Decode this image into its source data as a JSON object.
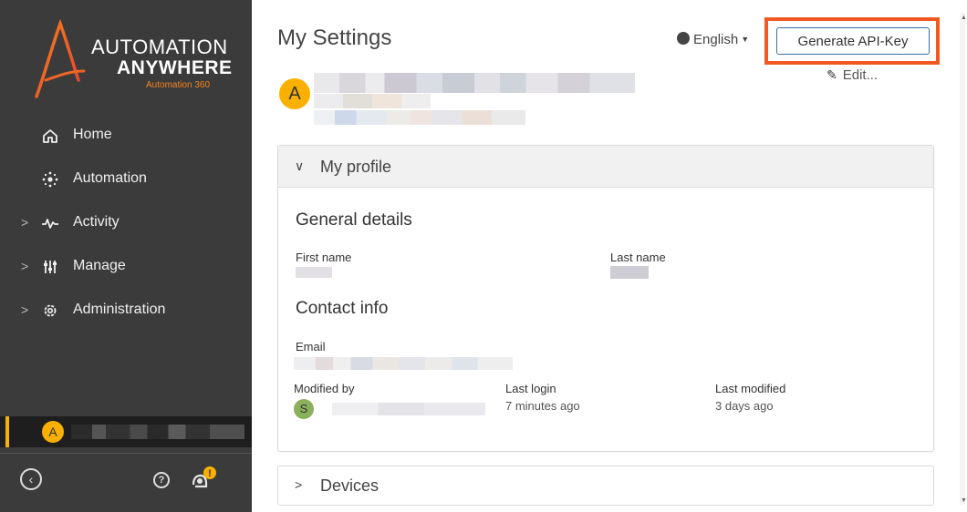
{
  "sidebar": {
    "logo": {
      "line1": "AUTOMATION",
      "line2": "ANYWHERE",
      "line3": "Automation 360",
      "accent_color": "#f58220"
    },
    "nav": [
      {
        "label": "Home",
        "icon": "home-icon",
        "expandable": false
      },
      {
        "label": "Automation",
        "icon": "automation-icon",
        "expandable": false
      },
      {
        "label": "Activity",
        "icon": "activity-icon",
        "expandable": true
      },
      {
        "label": "Manage",
        "icon": "manage-icon",
        "expandable": true
      },
      {
        "label": "Administration",
        "icon": "gear-icon",
        "expandable": true
      }
    ],
    "user": {
      "initial": "A"
    },
    "footer": {
      "collapse_glyph": "‹",
      "help_glyph": "?",
      "alert_glyph": "!"
    }
  },
  "header": {
    "title": "My Settings",
    "language": "English",
    "api_key_button": "Generate API-Key",
    "highlight_color": "#f05a22",
    "user_initial": "A"
  },
  "profile": {
    "header": "My profile",
    "general_title": "General details",
    "edit_label": "Edit...",
    "first_name_label": "First name",
    "last_name_label": "Last name",
    "contact_title": "Contact info",
    "email_label": "Email",
    "modified_by_label": "Modified by",
    "modified_by_initial": "S",
    "last_login_label": "Last login",
    "last_login_value": "7 minutes ago",
    "last_modified_label": "Last modified",
    "last_modified_value": "3 days ago"
  },
  "devices": {
    "header": "Devices"
  },
  "colors": {
    "sidebar_bg": "#3b3b3b",
    "avatar": "#f9b000",
    "button_border": "#3a6fa0"
  }
}
